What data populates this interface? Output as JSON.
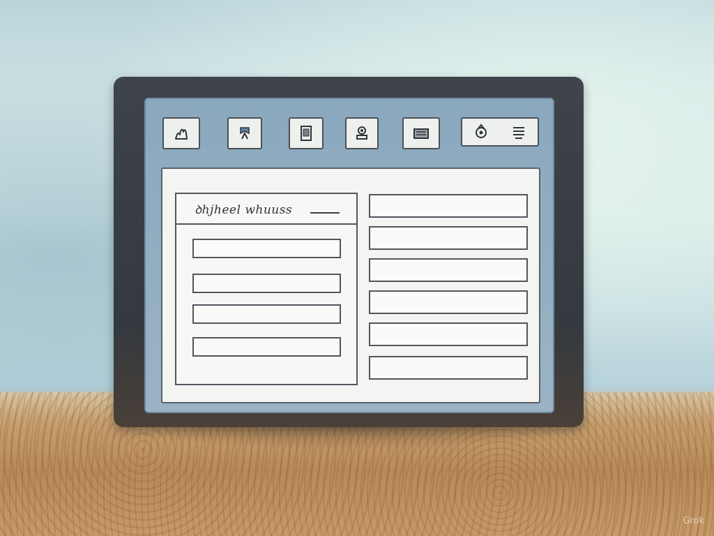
{
  "content_panel": {
    "header_text": "ꝺhjheel whuuss",
    "left_rows": [
      "",
      "",
      "",
      ""
    ],
    "right_rows": [
      "",
      "",
      "",
      "",
      "",
      ""
    ]
  },
  "toolbar": {
    "icons": [
      "figure-icon",
      "bookmark-icon",
      "document-icon",
      "stamp-icon",
      "card-icon",
      "ring-icon",
      "stack-icon"
    ]
  },
  "watermark": "Grok",
  "colors": {
    "frame": "#3e444a",
    "screen": "#8aa8be",
    "panel": "#f4f4f2",
    "border": "#50565c",
    "ground": "#b98a58"
  }
}
